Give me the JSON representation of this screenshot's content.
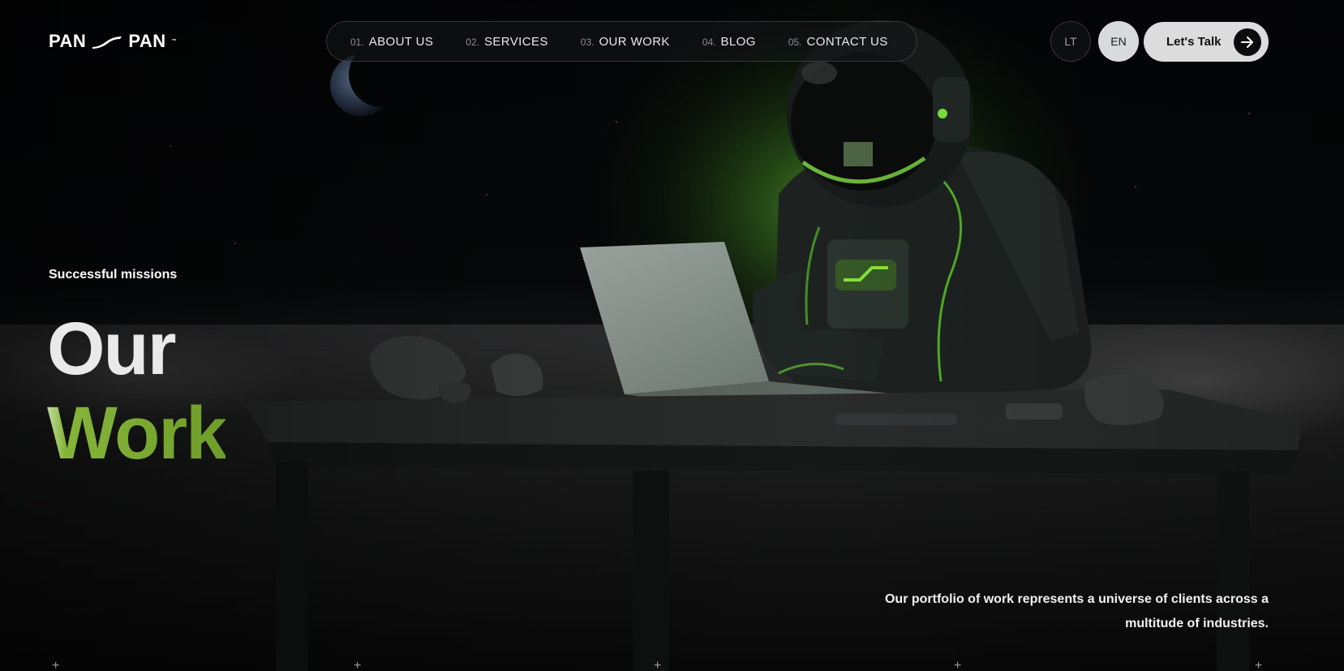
{
  "brand": {
    "logo_left": "PAN",
    "logo_right": "PAN",
    "trademark": "™"
  },
  "nav": {
    "items": [
      {
        "num": "01.",
        "label": "ABOUT US"
      },
      {
        "num": "02.",
        "label": "SERVICES"
      },
      {
        "num": "03.",
        "label": "OUR WORK"
      },
      {
        "num": "04.",
        "label": "BLOG"
      },
      {
        "num": "05.",
        "label": "CONTACT US"
      }
    ]
  },
  "languages": {
    "lt": "LT",
    "en": "EN",
    "active": "EN"
  },
  "cta": {
    "label": "Let's Talk",
    "icon": "arrow-right-icon"
  },
  "hero": {
    "eyebrow": "Successful missions",
    "title_line1": "Our",
    "title_line2": "Work",
    "description": "Our portfolio of work represents a universe of clients across a multitude of industries.",
    "background": "astronaut-at-laptop-on-moon-illustration"
  },
  "colors": {
    "accent_green": "#7aa82e",
    "glow_green": "#56be28",
    "background": "#050607",
    "cta_bg": "#dcdcdc"
  }
}
